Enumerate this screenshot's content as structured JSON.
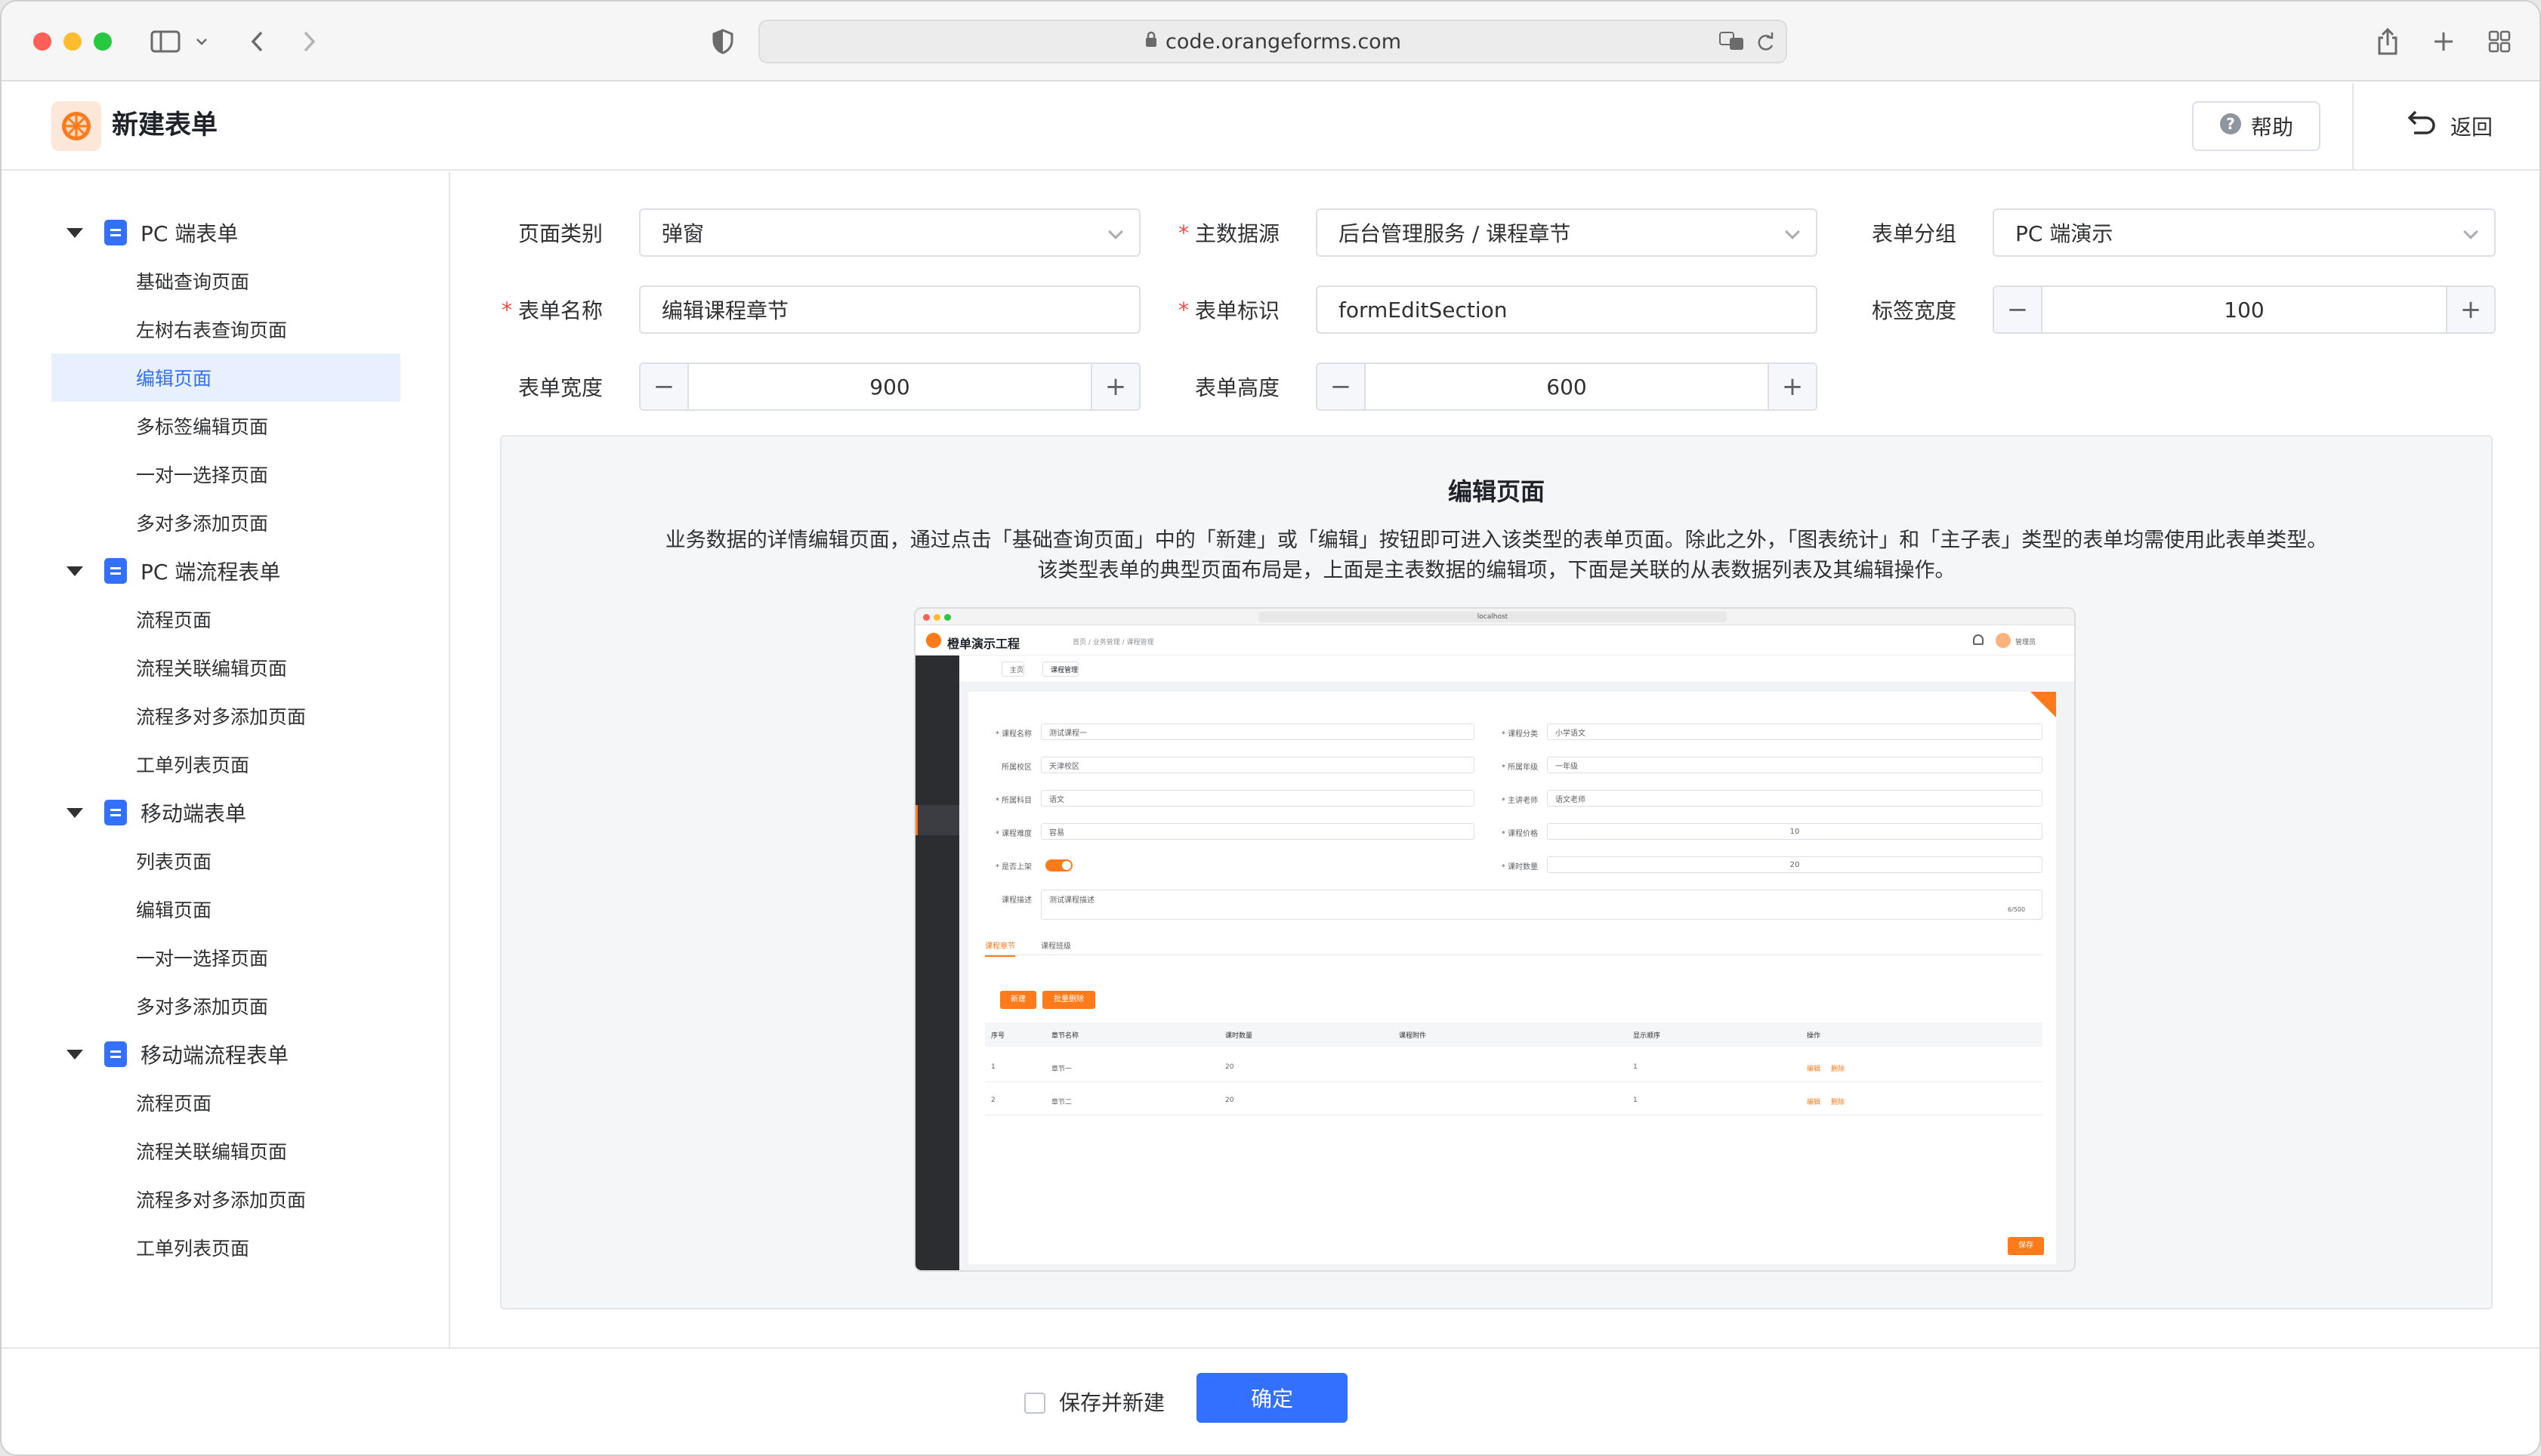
{
  "browser": {
    "url": "code.orangeforms.com"
  },
  "header": {
    "title": "新建表单",
    "help_label": "帮助",
    "back_label": "返回"
  },
  "sidebar": {
    "groups": [
      {
        "label": "PC 端表单",
        "items": [
          "基础查询页面",
          "左树右表查询页面",
          "编辑页面",
          "多标签编辑页面",
          "一对一选择页面",
          "多对多添加页面"
        ]
      },
      {
        "label": "PC 端流程表单",
        "items": [
          "流程页面",
          "流程关联编辑页面",
          "流程多对多添加页面",
          "工单列表页面"
        ]
      },
      {
        "label": "移动端表单",
        "items": [
          "列表页面",
          "编辑页面",
          "一对一选择页面",
          "多对多添加页面"
        ]
      },
      {
        "label": "移动端流程表单",
        "items": [
          "流程页面",
          "流程关联编辑页面",
          "流程多对多添加页面",
          "工单列表页面"
        ]
      }
    ],
    "active_item": "编辑页面"
  },
  "form": {
    "page_type_label": "页面类别",
    "page_type_value": "弹窗",
    "datasource_label": "主数据源",
    "datasource_value": "后台管理服务 / 课程章节",
    "group_label": "表单分组",
    "group_value": "PC 端演示",
    "name_label": "表单名称",
    "name_value": "编辑课程章节",
    "code_label": "表单标识",
    "code_value": "formEditSection",
    "label_width_label": "标签宽度",
    "label_width_value": "100",
    "width_label": "表单宽度",
    "width_value": "900",
    "height_label": "表单高度",
    "height_value": "600"
  },
  "preview": {
    "title": "编辑页面",
    "desc_line1": "业务数据的详情编辑页面，通过点击「基础查询页面」中的「新建」或「编辑」按钮即可进入该类型的表单页面。除此之外，「图表统计」和「主子表」类型的表单均需使用此表单类型。",
    "desc_line2": "该类型表单的典型页面布局是，上面是主表数据的编辑项，下面是关联的从表数据列表及其编辑操作。"
  },
  "thumb": {
    "url": "localhost",
    "app_name": "橙单演示工程",
    "crumb": "首页 / 业务管理 / 课程管理",
    "user": "管理员",
    "tab_home": "主页",
    "tab_active": "课程管理",
    "fields_left": [
      {
        "label": "* 课程名称",
        "value": "测试课程一"
      },
      {
        "label": "所属校区",
        "value": "天津校区"
      },
      {
        "label": "* 所属科目",
        "value": "语文"
      },
      {
        "label": "* 课程难度",
        "value": "容易"
      },
      {
        "label": "* 是否上架",
        "value": ""
      },
      {
        "label": "课程描述",
        "value": "测试课程描述"
      }
    ],
    "fields_right": [
      {
        "label": "* 课程分类",
        "value": "小学语文"
      },
      {
        "label": "* 所属年级",
        "value": "一年级"
      },
      {
        "label": "* 主讲老师",
        "value": "语文老师"
      },
      {
        "label": "* 课程价格",
        "value": "10"
      },
      {
        "label": "* 课时数量",
        "value": "20"
      }
    ],
    "desc_count": "6/500",
    "sub_tab_active": "课程章节",
    "sub_tab_other": "课程班级",
    "btn_new": "新建",
    "btn_batch_delete": "批量删除",
    "columns": [
      "序号",
      "章节名称",
      "课时数量",
      "课程附件",
      "显示顺序",
      "操作"
    ],
    "rows": [
      [
        "1",
        "章节一",
        "20",
        "",
        "1"
      ],
      [
        "2",
        "章节二",
        "20",
        "",
        "1"
      ]
    ],
    "op_edit": "编辑",
    "op_delete": "删除",
    "btn_save": "保存"
  },
  "footer": {
    "save_and_new_label": "保存并新建",
    "confirm_label": "确定"
  },
  "colors": {
    "primary": "#3370ff",
    "orange": "#ff7a1a",
    "required": "#f54a45"
  }
}
